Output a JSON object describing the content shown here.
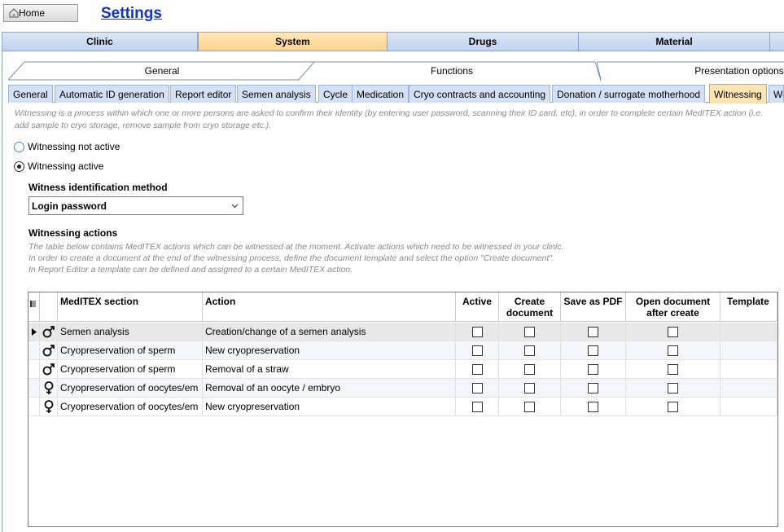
{
  "top": {
    "home_label": "Home",
    "page_title": "Settings"
  },
  "main_tabs": [
    {
      "label": "Clinic",
      "active": false
    },
    {
      "label": "System",
      "active": true
    },
    {
      "label": "Drugs",
      "active": false
    },
    {
      "label": "Material",
      "active": false
    }
  ],
  "sub_tabs": [
    {
      "label": "General",
      "active": false
    },
    {
      "label": "Functions",
      "active": true
    },
    {
      "label": "Presentation options",
      "active": false
    }
  ],
  "function_tabs": [
    {
      "label": "General",
      "active": false
    },
    {
      "label": "Automatic ID generation",
      "active": false
    },
    {
      "label": "Report editor",
      "active": false
    },
    {
      "label": "Semen analysis",
      "active": false
    },
    {
      "label": "Cycle",
      "active": false
    },
    {
      "label": "Medication",
      "active": false
    },
    {
      "label": "Cryo contracts and accounting",
      "active": false
    },
    {
      "label": "Donation / surrogate motherhood",
      "active": false
    },
    {
      "label": "Witnessing",
      "active": true
    },
    {
      "label": "We",
      "active": false
    }
  ],
  "witnessing": {
    "description": "Witnessing is a process within which one or more persons are asked to confirm their identity (by entering user password, scanning their ID card, etc), in order to complete certain MedITEX action (i.e. add sample to cryo storage, remove sample from cryo storage etc.).",
    "radio_inactive": "Witnessing not active",
    "radio_active": "Witnessing active",
    "selected_state": "active",
    "method_label": "Witness identification method",
    "method_value": "Login password",
    "actions_label": "Witnessing actions",
    "actions_desc_1": "The table below contains MedITEX actions which can be witnessed at the moment. Activate actions which need to be witnessed in your clinic.",
    "actions_desc_2": "In order to create a document at the end of the witnessing process, define the document template and select the option \"Create document\".",
    "actions_desc_3": "In Report Editor a template can be defined and assigned to a certain MedITEX action."
  },
  "grid": {
    "columns": {
      "section": "MedITEX section",
      "action": "Action",
      "active": "Active",
      "create_doc_1": "Create",
      "create_doc_2": "document",
      "save_pdf": "Save as PDF",
      "open_doc_1": "Open document",
      "open_doc_2": "after create",
      "template": "Template"
    },
    "rows": [
      {
        "gender": "male",
        "section": "Semen analysis",
        "action": "Creation/change of a semen analysis",
        "active": false,
        "create": false,
        "pdf": false,
        "open": false,
        "template": "",
        "selected": true
      },
      {
        "gender": "male",
        "section": "Cryopreservation of sperm",
        "action": "New cryopreservation",
        "active": false,
        "create": false,
        "pdf": false,
        "open": false,
        "template": "",
        "selected": false
      },
      {
        "gender": "male",
        "section": "Cryopreservation of sperm",
        "action": "Removal of a straw",
        "active": false,
        "create": false,
        "pdf": false,
        "open": false,
        "template": "",
        "selected": false
      },
      {
        "gender": "female",
        "section": "Cryopreservation of oocytes/em",
        "action": "Removal of an oocyte / embryo",
        "active": false,
        "create": false,
        "pdf": false,
        "open": false,
        "template": "",
        "selected": false
      },
      {
        "gender": "female",
        "section": "Cryopreservation of oocytes/em",
        "action": "New cryopreservation",
        "active": false,
        "create": false,
        "pdf": false,
        "open": false,
        "template": "",
        "selected": false
      }
    ]
  }
}
